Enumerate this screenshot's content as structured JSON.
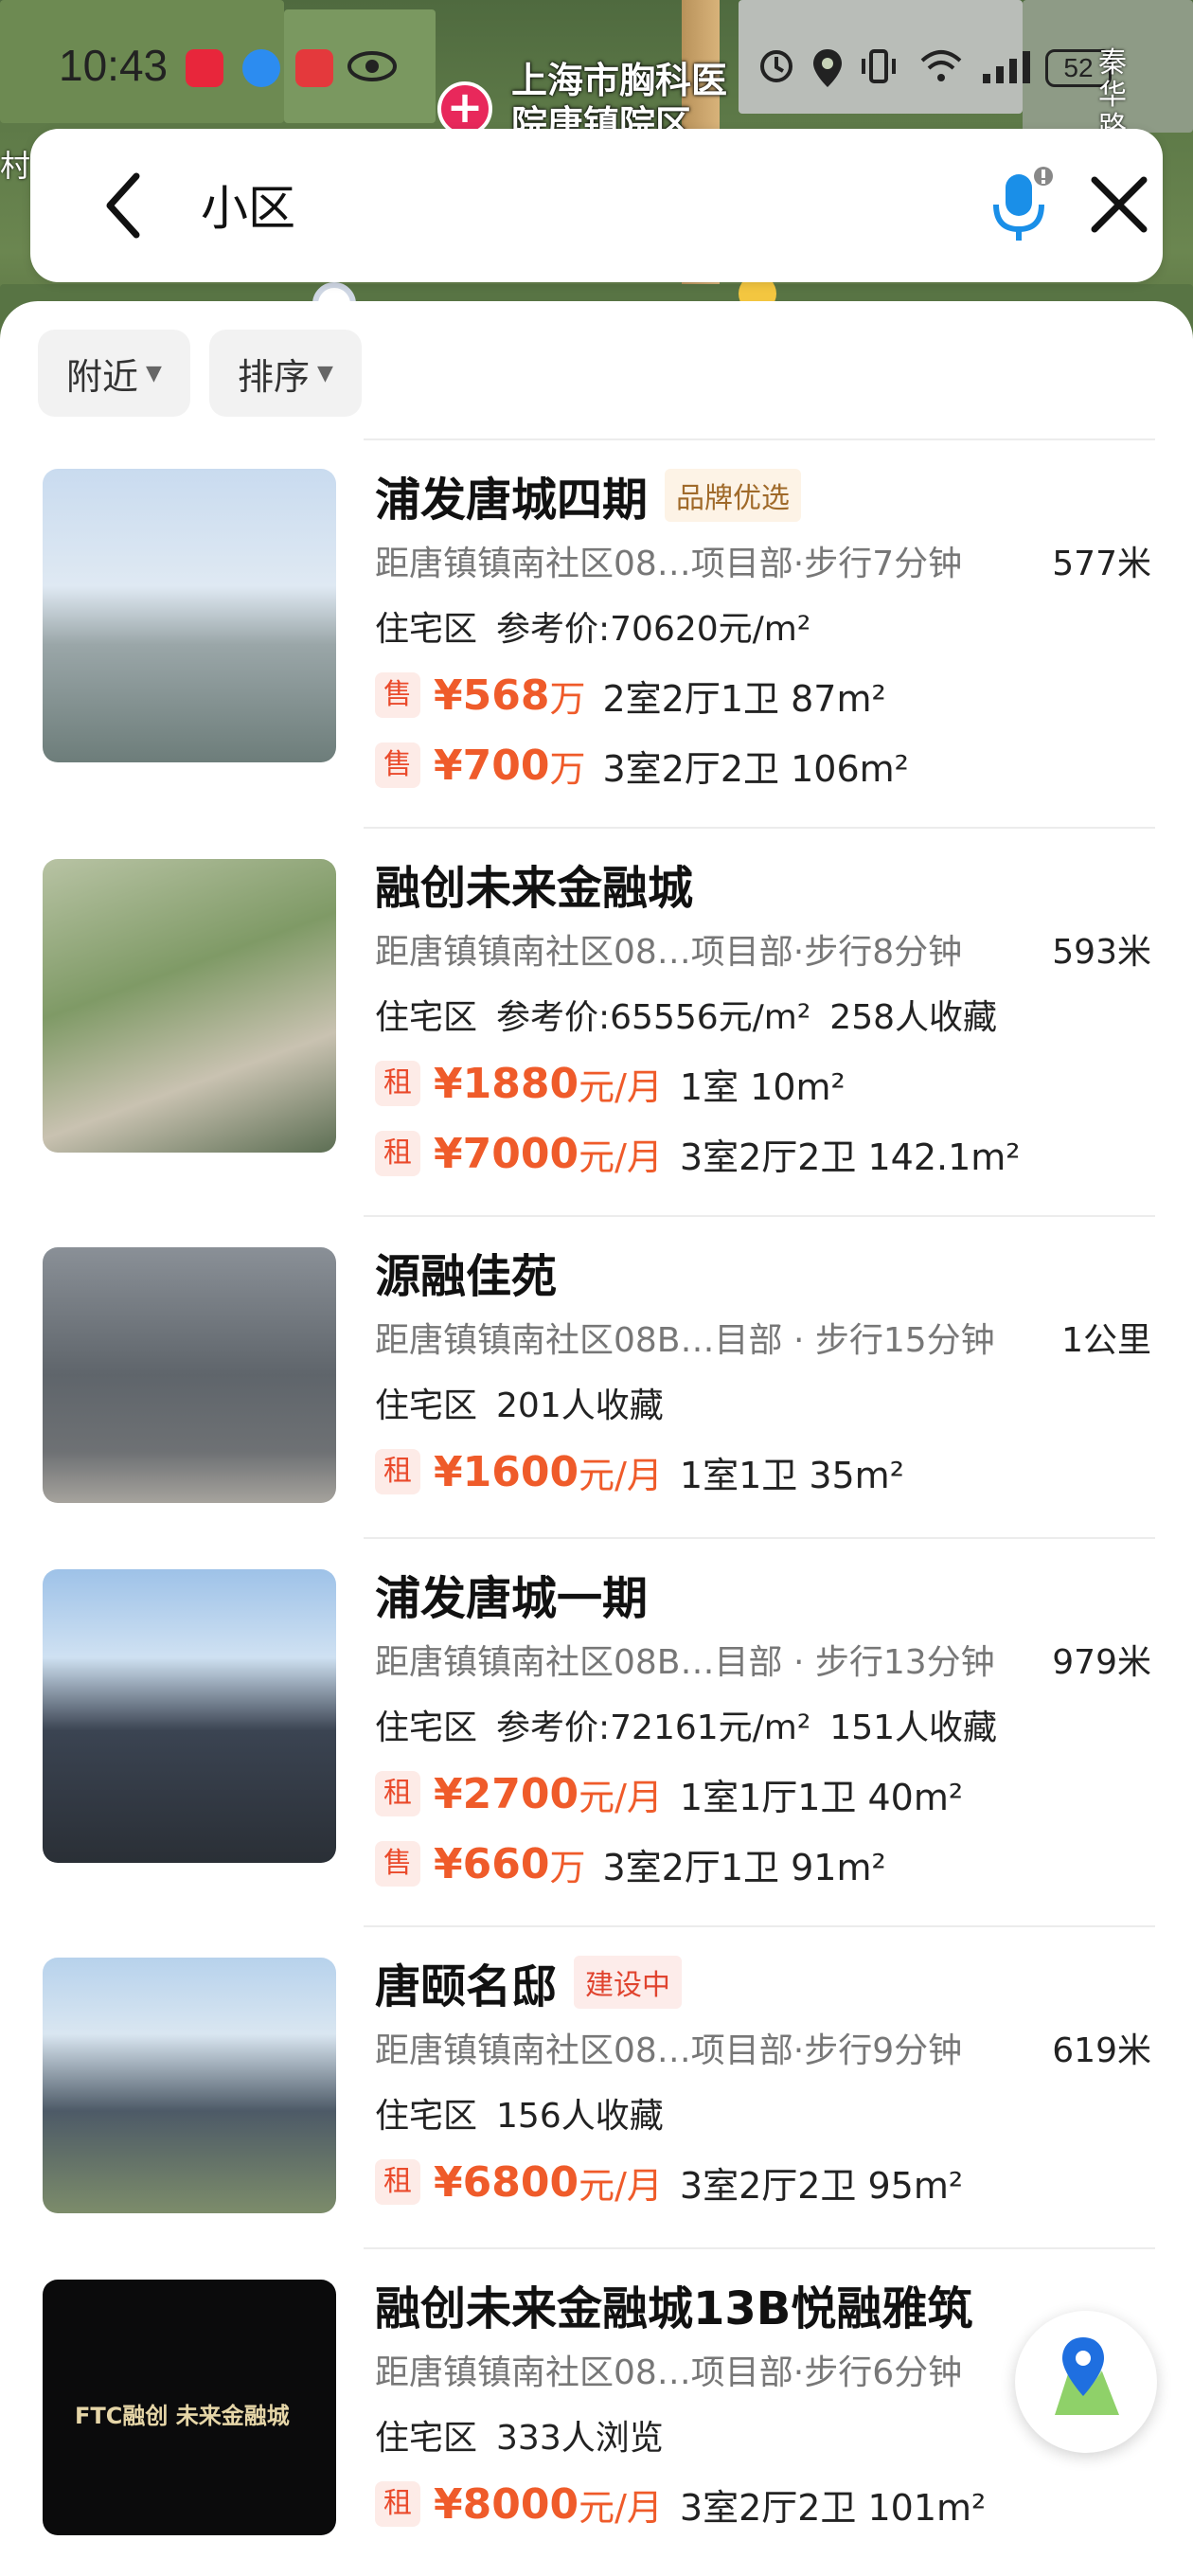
{
  "status_bar": {
    "time": "10:43",
    "battery": "52"
  },
  "map": {
    "poi_label_1": "上海市胸科医",
    "poi_label_2": "院唐镇院区",
    "road_label": "秦华路",
    "side_label": "村"
  },
  "search": {
    "query": "小区"
  },
  "filters": [
    {
      "label": "附近"
    },
    {
      "label": "排序"
    }
  ],
  "results": [
    {
      "title": "浦发唐城四期",
      "tag": "品牌优选",
      "tag_type": "brand",
      "address": "距唐镇镇南社区08…项目部·步行7分钟",
      "distance": "577米",
      "meta": [
        "住宅区",
        "参考价:70620元/m²"
      ],
      "prices": [
        {
          "badge": "售",
          "price": "¥568",
          "unit": "万",
          "layout": "2室2厅1卫 87m²"
        },
        {
          "badge": "售",
          "price": "¥700",
          "unit": "万",
          "layout": "3室2厅2卫 106m²"
        }
      ]
    },
    {
      "title": "融创未来金融城",
      "tag": "",
      "tag_type": "",
      "address": "距唐镇镇南社区08…项目部·步行8分钟",
      "distance": "593米",
      "meta": [
        "住宅区",
        "参考价:65556元/m²",
        "258人收藏"
      ],
      "prices": [
        {
          "badge": "租",
          "price": "¥1880",
          "unit": "元/月",
          "layout": "1室 10m²"
        },
        {
          "badge": "租",
          "price": "¥7000",
          "unit": "元/月",
          "layout": "3室2厅2卫 142.1m²"
        }
      ]
    },
    {
      "title": "源融佳苑",
      "tag": "",
      "tag_type": "",
      "address": "距唐镇镇南社区08B…目部 · 步行15分钟",
      "distance": "1公里",
      "meta": [
        "住宅区",
        "201人收藏"
      ],
      "prices": [
        {
          "badge": "租",
          "price": "¥1600",
          "unit": "元/月",
          "layout": "1室1卫 35m²"
        }
      ]
    },
    {
      "title": "浦发唐城一期",
      "tag": "",
      "tag_type": "",
      "address": "距唐镇镇南社区08B…目部 · 步行13分钟",
      "distance": "979米",
      "meta": [
        "住宅区",
        "参考价:72161元/m²",
        "151人收藏"
      ],
      "prices": [
        {
          "badge": "租",
          "price": "¥2700",
          "unit": "元/月",
          "layout": "1室1厅1卫 40m²"
        },
        {
          "badge": "售",
          "price": "¥660",
          "unit": "万",
          "layout": "3室2厅1卫 91m²"
        }
      ]
    },
    {
      "title": "唐颐名邸",
      "tag": "建设中",
      "tag_type": "building",
      "address": "距唐镇镇南社区08…项目部·步行9分钟",
      "distance": "619米",
      "meta": [
        "住宅区",
        "156人收藏"
      ],
      "prices": [
        {
          "badge": "租",
          "price": "¥6800",
          "unit": "元/月",
          "layout": "3室2厅2卫 95m²"
        }
      ]
    },
    {
      "title": "融创未来金融城13B悦融雅筑",
      "tag": "",
      "tag_type": "",
      "address": "距唐镇镇南社区08…项目部·步行6分钟",
      "distance": "",
      "meta": [
        "住宅区",
        "333人浏览"
      ],
      "prices": [
        {
          "badge": "租",
          "price": "¥8000",
          "unit": "元/月",
          "layout": "3室2厅2卫 101m²"
        }
      ]
    }
  ],
  "thumb_sign": "FTC融创 未来金融城",
  "colors": {
    "price": "#ef5b2a",
    "brand_tag_bg": "#fdf3e6",
    "building_tag": "#e0442f",
    "mic_blue": "#1a8fe8"
  }
}
